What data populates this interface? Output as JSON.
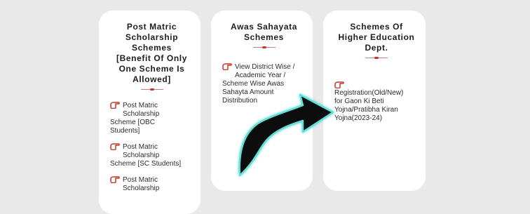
{
  "colors": {
    "background": "#e9e9ea",
    "card": "#ffffff",
    "accent": "#c0392b"
  },
  "icons": {
    "bullet": "pointing-hand-icon",
    "overlay": "curved-arrow-icon"
  },
  "cards": [
    {
      "title_lines": [
        "Post Matric",
        "Scholarship",
        "Schemes",
        "[Benefit Of Only",
        "One Scheme Is",
        "Allowed]"
      ],
      "items": [
        {
          "lines": [
            "Post Matric",
            "Scholarship",
            "Scheme [OBC",
            "Students]"
          ]
        },
        {
          "lines": [
            "Post Matric",
            "Scholarship",
            "Scheme [SC Students]"
          ]
        },
        {
          "lines": [
            "Post Matric",
            "Scholarship"
          ]
        }
      ]
    },
    {
      "title_lines": [
        "Awas Sahayata",
        "Schemes"
      ],
      "items": [
        {
          "lines": [
            "View District Wise /",
            "Academic Year /",
            "Scheme Wise Awas",
            "Sahayta Amount",
            "Distribution"
          ]
        }
      ]
    },
    {
      "title_lines": [
        "Schemes Of",
        "Higher Education",
        "Dept."
      ],
      "items": [
        {
          "lines": [
            "Registration(Old/New)",
            "for Gaon Ki Beti",
            "Yojna/Pratibha Kiran",
            "Yojna(2023-24)"
          ]
        }
      ]
    }
  ]
}
